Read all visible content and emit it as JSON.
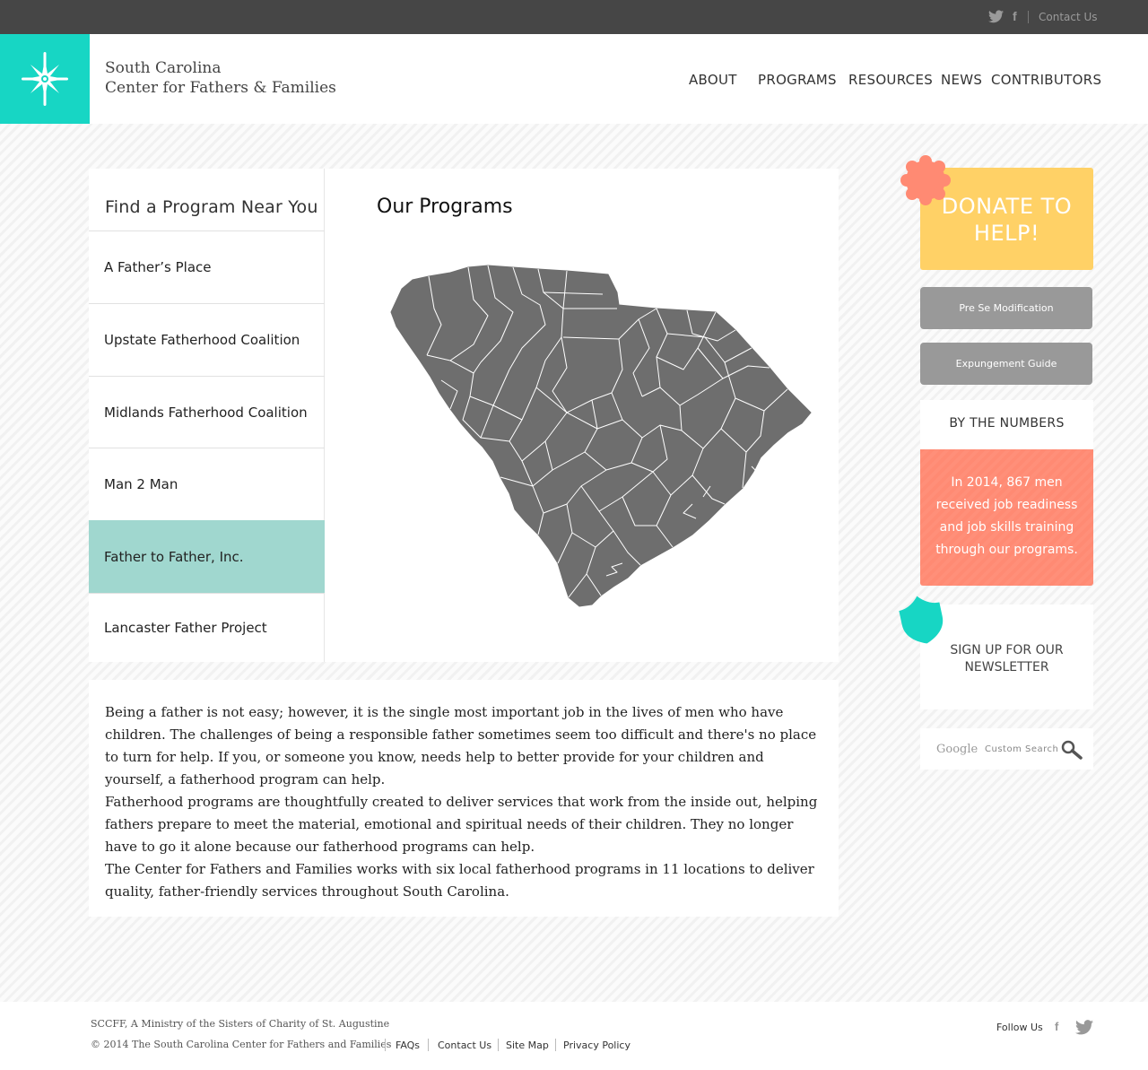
{
  "topbar": {
    "contact_label": "Contact Us",
    "icons": [
      "twitter-icon",
      "facebook-icon"
    ]
  },
  "header": {
    "site_name_line1": "South Carolina",
    "site_name_line2": "Center for Fathers & Families",
    "nav": [
      "ABOUT",
      "PROGRAMS",
      "RESOURCES",
      "NEWS",
      "CONTRIBUTORS"
    ]
  },
  "sidebar": {
    "title": "Find a Program Near You",
    "items": [
      "A Father’s Place",
      "Upstate Fatherhood Coalition",
      "Midlands Fatherhood Coalition",
      "Man 2 Man",
      "Father to Father, Inc.",
      "Lancaster Father Project"
    ],
    "active_index": 4
  },
  "main": {
    "title": "Our Programs",
    "map_icon": "south-carolina-county-map"
  },
  "body_text": {
    "p1": "Being a father is not easy; however, it is the single most important job in the lives of men who have children. The challenges of being a responsible father sometimes seem too difficult and there's no place to turn for help. If you, or someone you know, needs help to better provide for your children and yourself, a fatherhood program can help.",
    "p2": "Fatherhood programs are thoughtfully created to deliver services that work from the inside out, helping fathers prepare to meet the material, emotional and spiritual needs of their children. They no longer have to go it alone because our fatherhood programs can help.",
    "p3": "The Center for Fathers and Families works with six local fatherhood programs in 11 locations to deliver quality, father-friendly services throughout South Carolina."
  },
  "right": {
    "donate_line1": "DONATE TO",
    "donate_line2": "HELP!",
    "button1": "Pre Se Modification",
    "button2": "Expungement Guide",
    "numbers_title": "BY THE NUMBERS",
    "numbers_text": "In 2014, 867 men received job readiness and job skills training through our programs.",
    "newsletter_line1": "SIGN UP FOR OUR",
    "newsletter_line2": "NEWSLETTER",
    "search_google": "Google",
    "search_custom": "Custom Search"
  },
  "footer": {
    "ministry": "SCCFF, A Ministry of the Sisters of Charity of St. Augustine",
    "copyright": "© 2014 The South Carolina Center for Fathers and Families",
    "links": [
      "FAQs",
      "Contact Us",
      "Site Map",
      "Privacy Policy"
    ],
    "follow": "Follow Us"
  },
  "colors": {
    "accent_teal": "#17d6c4",
    "active_item": "#a0d7cf",
    "donate_yellow": "#ffd166",
    "coral": "#ff8a73",
    "map_gray": "#6e6e6e",
    "topbar": "#464646"
  }
}
